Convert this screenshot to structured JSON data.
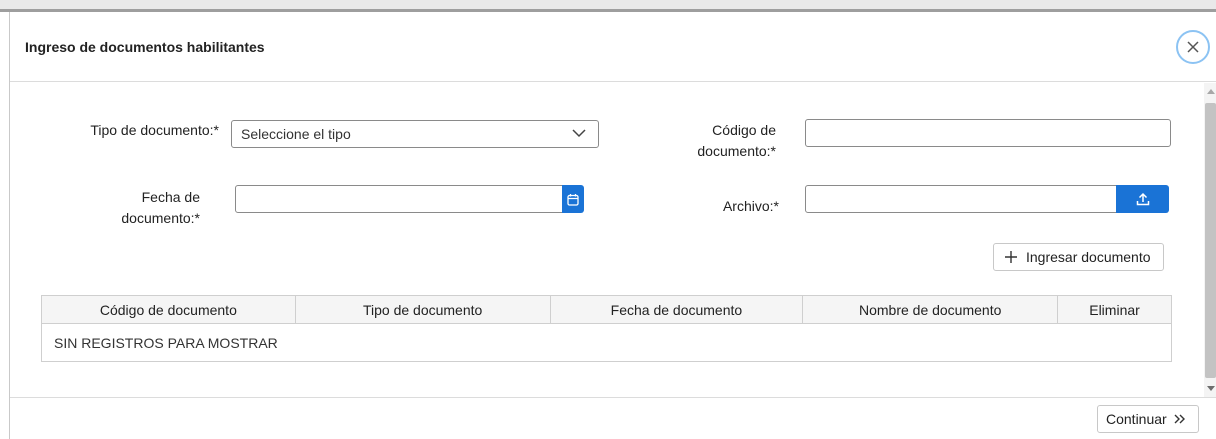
{
  "modal": {
    "title": "Ingreso de documentos habilitantes"
  },
  "form": {
    "tipo_label": "Tipo de documento:*",
    "tipo_placeholder": "Seleccione el tipo",
    "codigo_label_line1": "Código de",
    "codigo_label_line2": "documento:*",
    "codigo_value": "",
    "fecha_label_line1": "Fecha de",
    "fecha_label_line2": "documento:*",
    "fecha_value": "",
    "archivo_label": "Archivo:*",
    "archivo_value": "",
    "add_button_label": "Ingresar documento"
  },
  "table": {
    "columns": [
      "Código de documento",
      "Tipo de documento",
      "Fecha de documento",
      "Nombre de documento",
      "Eliminar"
    ],
    "empty_text": "SIN REGISTROS PARA MOSTRAR"
  },
  "footer": {
    "continue_label": "Continuar"
  },
  "icons": {
    "close": "close-icon",
    "chevron": "chevron-down-icon",
    "calendar": "calendar-icon",
    "upload": "upload-icon",
    "plus": "plus-icon",
    "double_chevron": "double-chevron-right-icon"
  },
  "colors": {
    "accent": "#1a73d6",
    "close_ring": "#8cc3f3"
  }
}
